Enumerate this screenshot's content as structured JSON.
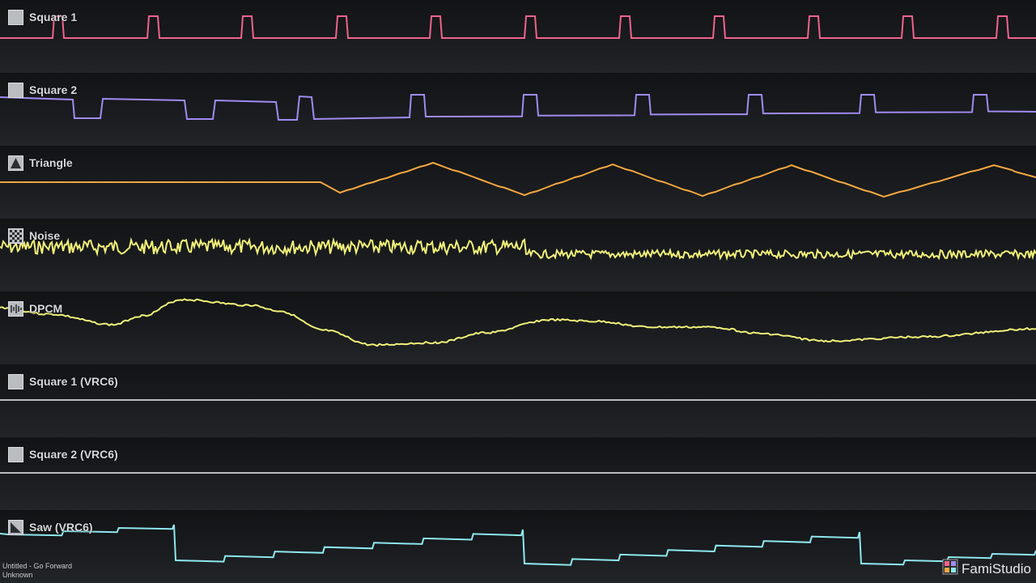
{
  "channels": [
    {
      "id": "square1",
      "label": "Square 1",
      "icon": "square-wave-icon",
      "color": "#f0638c",
      "wave": "square-short"
    },
    {
      "id": "square2",
      "label": "Square 2",
      "icon": "square-wave-icon",
      "color": "#a18bf0",
      "wave": "square-wide"
    },
    {
      "id": "triangle",
      "label": "Triangle",
      "icon": "triangle-wave-icon",
      "color": "#f3a640",
      "wave": "triangle"
    },
    {
      "id": "noise",
      "label": "Noise",
      "icon": "noise-icon",
      "color": "#f1f079",
      "wave": "noise"
    },
    {
      "id": "dpcm",
      "label": "DPCM",
      "icon": "dpcm-icon",
      "color": "#f1f079",
      "wave": "dpcm"
    },
    {
      "id": "square1_vrc6",
      "label": "Square 1 (VRC6)",
      "icon": "square-wave-icon",
      "color": "#b8babd",
      "wave": "flat"
    },
    {
      "id": "square2_vrc6",
      "label": "Square 2 (VRC6)",
      "icon": "square-wave-icon",
      "color": "#b8babd",
      "wave": "flat"
    },
    {
      "id": "saw_vrc6",
      "label": "Saw (VRC6)",
      "icon": "saw-wave-icon",
      "color": "#8ee8ee",
      "wave": "saw"
    }
  ],
  "footer": {
    "song": "Untitled - Go Forward",
    "author": "Unknown"
  },
  "brand": {
    "name": "FamiStudio",
    "icon": "famistudio-logo-icon"
  }
}
